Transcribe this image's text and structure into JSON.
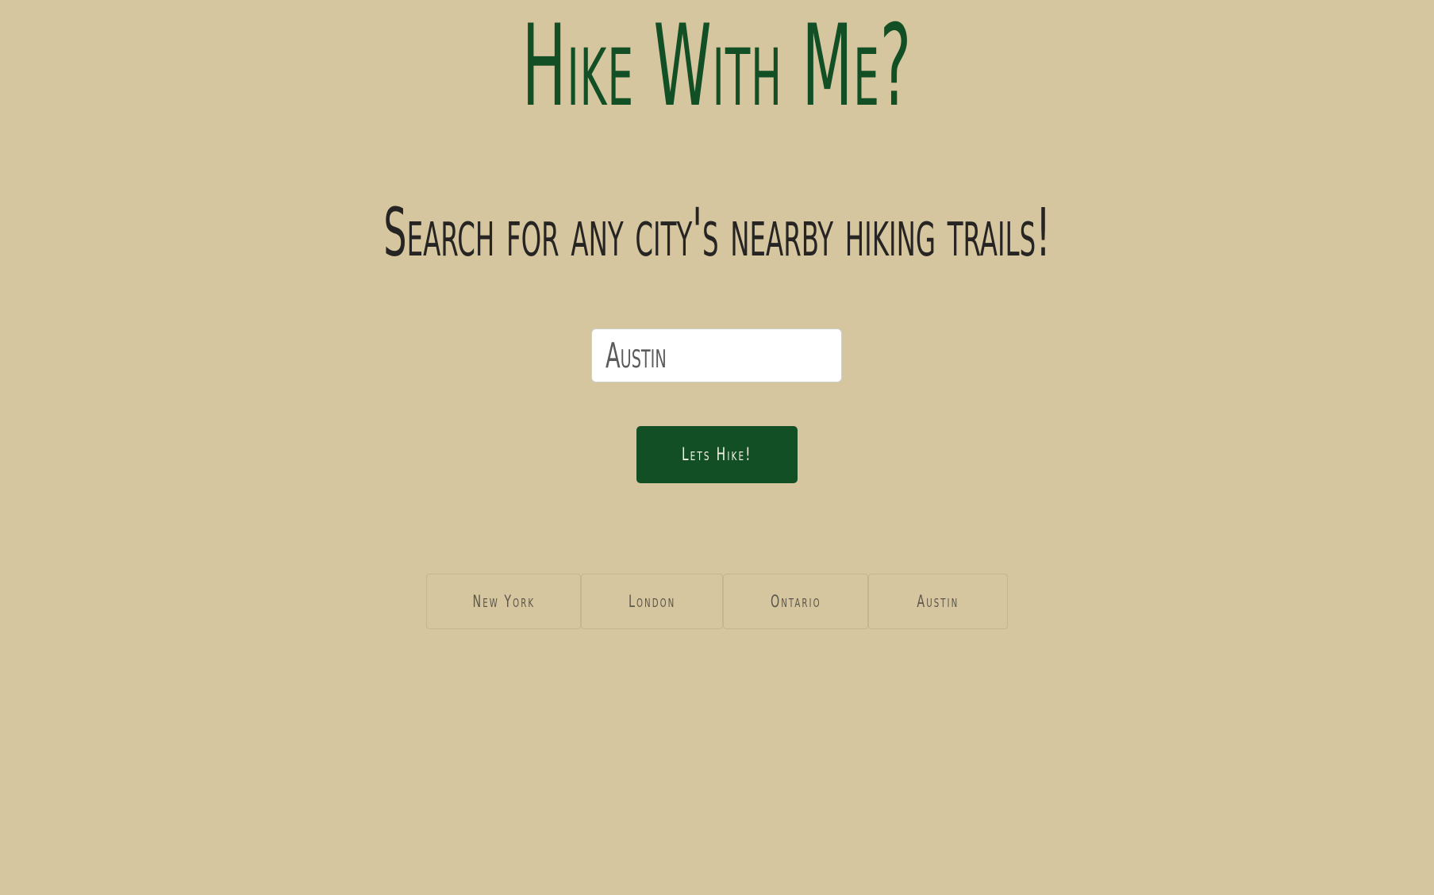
{
  "header": {
    "title": "Hike With Me?",
    "subtitle": "Search for any city's nearby hiking trails!"
  },
  "search": {
    "value": "Austin",
    "button_label": "Lets Hike!"
  },
  "history": {
    "items": [
      {
        "label": "New York"
      },
      {
        "label": "London"
      },
      {
        "label": "Ontario"
      },
      {
        "label": "Austin"
      }
    ]
  },
  "colors": {
    "background": "#d5c69f",
    "accent": "#134f25",
    "text": "#262523"
  }
}
